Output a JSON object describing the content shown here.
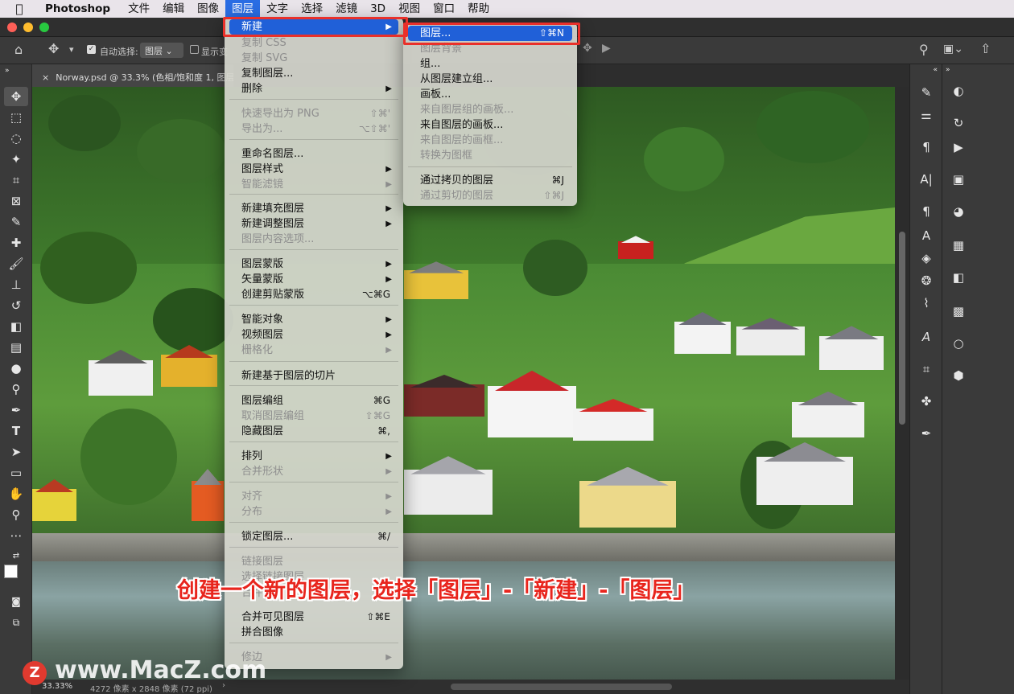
{
  "menubar": {
    "app_name": "Photoshop",
    "items": [
      "文件",
      "编辑",
      "图像",
      "图层",
      "文字",
      "选择",
      "滤镜",
      "3D",
      "视图",
      "窗口",
      "帮助"
    ]
  },
  "options_bar": {
    "auto_select_label": "自动选择:",
    "auto_select_value": "图层",
    "show_transform_label": "显示变"
  },
  "document_tab": {
    "title": "Norway.psd @ 33.3% (色相/饱和度 1, 图层"
  },
  "status_bar": {
    "zoom": "33.33%",
    "doc_info": "4272 像素 x 2848 像素 (72 ppi)"
  },
  "layer_menu": {
    "items": [
      {
        "label": "新建",
        "submenu": true,
        "highlighted": true
      },
      {
        "label": "复制 CSS",
        "disabled": true
      },
      {
        "label": "复制 SVG",
        "disabled": true
      },
      {
        "label": "复制图层..."
      },
      {
        "label": "删除",
        "submenu": true
      },
      {
        "label": "快速导出为 PNG",
        "shortcut": "⇧⌘'",
        "disabled": true
      },
      {
        "label": "导出为...",
        "shortcut": "⌥⇧⌘'",
        "disabled": true
      },
      {
        "label": "重命名图层..."
      },
      {
        "label": "图层样式",
        "submenu": true
      },
      {
        "label": "智能滤镜",
        "submenu": true,
        "disabled": true
      },
      {
        "label": "新建填充图层",
        "submenu": true
      },
      {
        "label": "新建调整图层",
        "submenu": true
      },
      {
        "label": "图层内容选项...",
        "disabled": true
      },
      {
        "label": "图层蒙版",
        "submenu": true
      },
      {
        "label": "矢量蒙版",
        "submenu": true
      },
      {
        "label": "创建剪贴蒙版",
        "shortcut": "⌥⌘G"
      },
      {
        "label": "智能对象",
        "submenu": true
      },
      {
        "label": "视频图层",
        "submenu": true
      },
      {
        "label": "栅格化",
        "submenu": true,
        "disabled": true
      },
      {
        "label": "新建基于图层的切片"
      },
      {
        "label": "图层编组",
        "shortcut": "⌘G"
      },
      {
        "label": "取消图层编组",
        "shortcut": "⇧⌘G",
        "disabled": true
      },
      {
        "label": "隐藏图层",
        "shortcut": "⌘,"
      },
      {
        "label": "排列",
        "submenu": true
      },
      {
        "label": "合并形状",
        "submenu": true,
        "disabled": true
      },
      {
        "label": "对齐",
        "submenu": true,
        "disabled": true
      },
      {
        "label": "分布",
        "submenu": true,
        "disabled": true
      },
      {
        "label": "锁定图层...",
        "shortcut": "⌘/"
      },
      {
        "label": "链接图层",
        "disabled": true
      },
      {
        "label": "选择链接图层",
        "disabled": true
      },
      {
        "label": "合并图层",
        "disabled": true
      },
      {
        "label": "合并可见图层",
        "shortcut": "⇧⌘E"
      },
      {
        "label": "拼合图像"
      },
      {
        "label": "修边",
        "submenu": true,
        "disabled": true
      }
    ]
  },
  "new_submenu": {
    "items": [
      {
        "label": "图层...",
        "shortcut": "⇧⌘N",
        "highlighted": true
      },
      {
        "label": "图层背景",
        "disabled": true
      },
      {
        "label": "组..."
      },
      {
        "label": "从图层建立组..."
      },
      {
        "label": "画板..."
      },
      {
        "label": "来自图层组的画板...",
        "disabled": true
      },
      {
        "label": "来自图层的画板..."
      },
      {
        "label": "来自图层的画框...",
        "disabled": true
      },
      {
        "label": "转换为图框",
        "disabled": true
      },
      {
        "label": "通过拷贝的图层",
        "shortcut": "⌘J"
      },
      {
        "label": "通过剪切的图层",
        "shortcut": "⇧⌘J",
        "disabled": true
      }
    ]
  },
  "caption": "创建一个新的图层，选择「图层」-「新建」-「图层」",
  "watermark": "www.MacZ.com",
  "watermark_logo": "Z",
  "colors": {
    "highlight": "#2060d8",
    "annotation_red": "#e9302a"
  },
  "icons": {
    "apple": "apple-icon",
    "home": "home-icon",
    "move": "move-tool-icon",
    "search": "search-icon",
    "share": "share-icon"
  }
}
